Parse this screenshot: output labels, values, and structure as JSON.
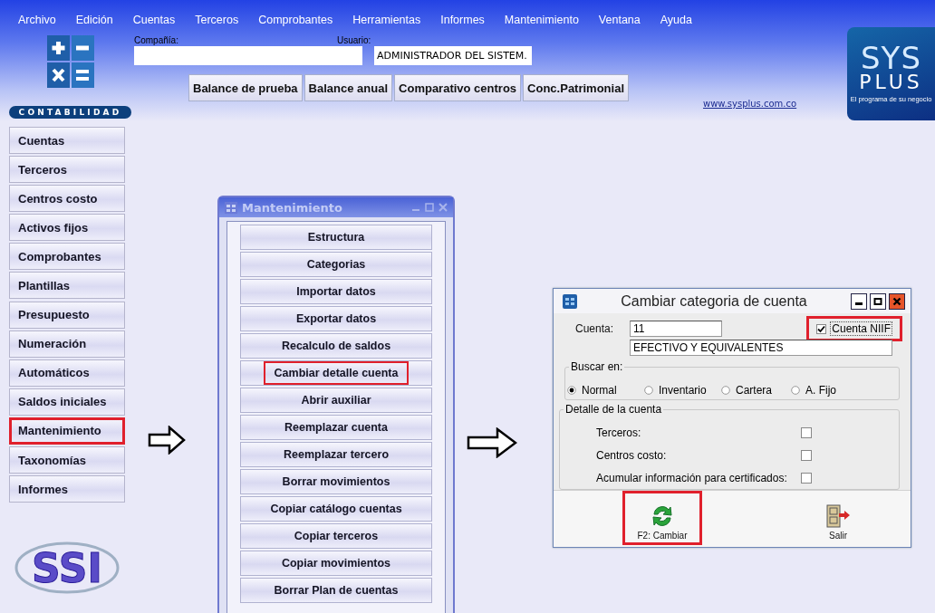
{
  "menu_bar": [
    "Archivo",
    "Edición",
    "Cuentas",
    "Terceros",
    "Comprobantes",
    "Herramientas",
    "Informes",
    "Mantenimiento",
    "Ventana",
    "Ayuda"
  ],
  "header": {
    "company_label": "Compañía:",
    "user_label": "Usuario:",
    "user_value": "ADMINISTRADOR DEL SISTEM.",
    "report_buttons": [
      "Balance de prueba",
      "Balance anual",
      "Comparativo centros",
      "Conc.Patrimonial"
    ],
    "website": "www.sysplus.com.co",
    "logo": {
      "title": "SYS",
      "subtitle": "PLUS",
      "tagline": "El programa de su negocio"
    }
  },
  "sidebar": {
    "title": "CONTABILIDAD",
    "items": [
      {
        "label": "Cuentas",
        "highlighted": false
      },
      {
        "label": "Terceros",
        "highlighted": false
      },
      {
        "label": "Centros costo",
        "highlighted": false
      },
      {
        "label": "Activos fijos",
        "highlighted": false
      },
      {
        "label": "Comprobantes",
        "highlighted": false
      },
      {
        "label": "Plantillas",
        "highlighted": false
      },
      {
        "label": "Presupuesto",
        "highlighted": false
      },
      {
        "label": "Numeración",
        "highlighted": false
      },
      {
        "label": "Automáticos",
        "highlighted": false
      },
      {
        "label": "Saldos iniciales",
        "highlighted": false
      },
      {
        "label": "Mantenimiento",
        "highlighted": true
      },
      {
        "label": "Taxonomías",
        "highlighted": false
      },
      {
        "label": "Informes",
        "highlighted": false
      }
    ],
    "brand": "SSI"
  },
  "maintenance_window": {
    "title": "Mantenimiento",
    "active": false,
    "buttons": [
      {
        "label": "Estructura",
        "highlighted": false
      },
      {
        "label": "Categorias",
        "highlighted": false
      },
      {
        "label": "Importar datos",
        "highlighted": false
      },
      {
        "label": "Exportar datos",
        "highlighted": false
      },
      {
        "label": "Recalculo de saldos",
        "highlighted": false
      },
      {
        "label": "Cambiar detalle cuenta",
        "highlighted": true
      },
      {
        "label": "Abrir auxiliar",
        "highlighted": false
      },
      {
        "label": "Reemplazar cuenta",
        "highlighted": false
      },
      {
        "label": "Reemplazar tercero",
        "highlighted": false
      },
      {
        "label": "Borrar movimientos",
        "highlighted": false
      },
      {
        "label": "Copiar catálogo cuentas",
        "highlighted": false
      },
      {
        "label": "Copiar terceros",
        "highlighted": false
      },
      {
        "label": "Copiar movimientos",
        "highlighted": false
      },
      {
        "label": "Borrar Plan de cuentas",
        "highlighted": false
      }
    ]
  },
  "dialog": {
    "title": "Cambiar categoria de cuenta",
    "account_label": "Cuenta:",
    "account_value": "11",
    "niif_checkbox": {
      "label": "Cuenta NIIF",
      "checked": true,
      "highlighted": true
    },
    "description_value": "EFECTIVO Y EQUIVALENTES",
    "search_group": {
      "title": "Buscar en:",
      "options": [
        {
          "label": "Normal",
          "selected": true
        },
        {
          "label": "Inventario",
          "selected": false
        },
        {
          "label": "Cartera",
          "selected": false
        },
        {
          "label": "A. Fijo",
          "selected": false
        }
      ]
    },
    "detail_group": {
      "title": "Detalle de la cuenta",
      "options": [
        {
          "label": "Terceros:",
          "checked": false
        },
        {
          "label": "Centros costo:",
          "checked": false
        },
        {
          "label": "Acumular información para certificados:",
          "checked": false
        }
      ]
    },
    "actions": [
      {
        "label": "F2: Cambiar",
        "kind": "refresh",
        "highlighted": true
      },
      {
        "label": "Salir",
        "kind": "exit",
        "highlighted": false
      }
    ]
  }
}
